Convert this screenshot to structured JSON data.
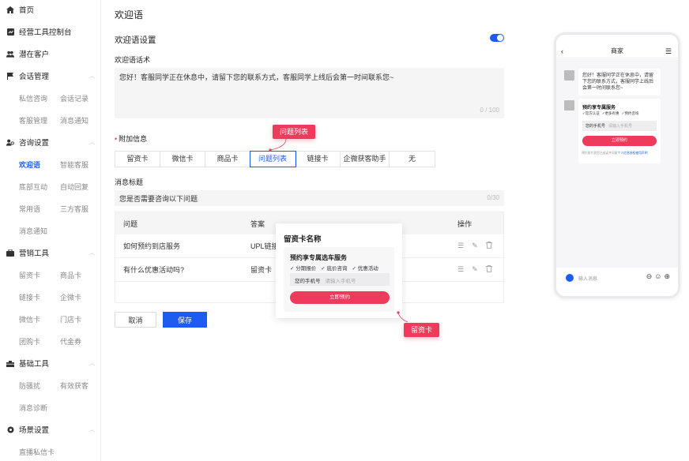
{
  "sidebar": {
    "home": "首页",
    "console": "经营工具控制台",
    "potential": "潜在客户",
    "session": {
      "title": "会话管理",
      "items": [
        "私信咨询",
        "会话记录",
        "客服管理",
        "消息通知"
      ]
    },
    "consult": {
      "title": "咨询设置",
      "items": [
        "欢迎语",
        "智能客服",
        "底部互动",
        "自动回复",
        "常用语",
        "三方客服",
        "消息通知"
      ]
    },
    "marketing": {
      "title": "营销工具",
      "items": [
        "留资卡",
        "商品卡",
        "链接卡",
        "企微卡",
        "微信卡",
        "门店卡",
        "团购卡",
        "代金券"
      ]
    },
    "basic": {
      "title": "基础工具",
      "items": [
        "防骚扰",
        "有效获客",
        "消息诊断"
      ]
    },
    "scene": {
      "title": "场景设置",
      "items": [
        "直播私信卡"
      ]
    }
  },
  "page_title": "欢迎语",
  "welcome_section": {
    "title": "欢迎语设置",
    "toggle_on": true,
    "label": "欢迎语话术",
    "text": "您好！客服同学正在休息中，请留下您的联系方式，客服同学上线后会第一时间联系您~",
    "count": "0 / 100"
  },
  "extra_info": {
    "label": "附加信息",
    "tabs": [
      "留资卡",
      "微信卡",
      "商品卡",
      "问题列表",
      "链接卡",
      "企微获客助手",
      "无"
    ],
    "selected": "问题列表"
  },
  "message_title": {
    "label": "消息标题",
    "value": "您是否需要咨询以下问题",
    "count": "0/30"
  },
  "table": {
    "headers": [
      "问题",
      "答案",
      "操作"
    ],
    "rows": [
      {
        "question": "如何预约到店服务",
        "answer": "UPL链接"
      },
      {
        "question": "有什么优惠活动吗?",
        "answer": "留资卡"
      }
    ]
  },
  "buttons": {
    "cancel": "取消",
    "save": "保存"
  },
  "callouts": {
    "question_list": "问题列表",
    "lead_card": "留资卡"
  },
  "card_popup": {
    "title": "留资卡名称",
    "card_title": "预约享专属选车服务",
    "checks": [
      "分期报价",
      "底价咨询",
      "优惠活动"
    ],
    "phone_label": "您的手机号",
    "phone_placeholder": "请输入手机号",
    "button": "立即预约"
  },
  "phone": {
    "title": "商家",
    "greeting": "您好！客服同学正在休息中，请留下您的联系方式，客服同学上线后会第一时间联系您~",
    "card_title": "预约享专属服务",
    "checks": [
      "官方认证",
      "更多有惠",
      "预约咨询"
    ],
    "phone_label": "您的手机号",
    "phone_placeholder": "请输入手机号",
    "button": "立即预约",
    "note_prefix": "预约即代表您已阅读并同意",
    "note_link": "个人信息授权使用声明",
    "input_placeholder": "输入消息"
  },
  "colors": {
    "accent": "#1e5cf0",
    "highlight": "#ef3b5b"
  }
}
